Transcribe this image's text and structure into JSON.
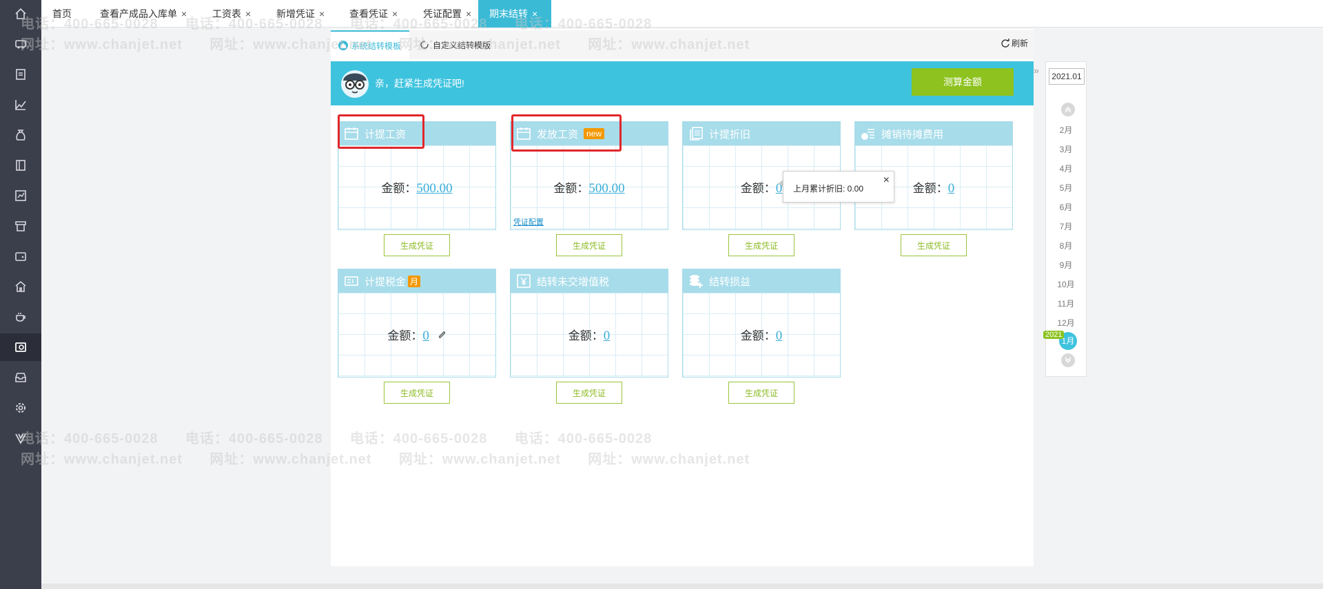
{
  "nav": {
    "items": [
      {
        "name": "home-icon",
        "icon": "home"
      },
      {
        "name": "car-icon",
        "icon": "car"
      },
      {
        "name": "list-icon",
        "icon": "list"
      },
      {
        "name": "chart-icon",
        "icon": "chart"
      },
      {
        "name": "money-bag-icon",
        "icon": "money-bag"
      },
      {
        "name": "book-icon",
        "icon": "book"
      },
      {
        "name": "report-icon",
        "icon": "report"
      },
      {
        "name": "store-icon",
        "icon": "store"
      },
      {
        "name": "wallet-icon",
        "icon": "wallet"
      },
      {
        "name": "building-icon",
        "icon": "building"
      },
      {
        "name": "tea-cup-icon",
        "icon": "tea-cup"
      },
      {
        "name": "voucher-icon",
        "icon": "voucher"
      },
      {
        "name": "inbox-icon",
        "icon": "inbox"
      },
      {
        "name": "settings-icon",
        "icon": "gear"
      },
      {
        "name": "v-logo-icon",
        "icon": "v-logo"
      }
    ]
  },
  "tabs": [
    {
      "label": "首页",
      "closable": false
    },
    {
      "label": "查看产成品入库单",
      "closable": true
    },
    {
      "label": "工资表",
      "closable": true
    },
    {
      "label": "新增凭证",
      "closable": true
    },
    {
      "label": "查看凭证",
      "closable": true
    },
    {
      "label": "凭证配置",
      "closable": true
    },
    {
      "label": "期末结转",
      "closable": true,
      "active": true
    }
  ],
  "close_glyph": "×",
  "subtabs": [
    {
      "label": "系统结转模板",
      "active": true
    },
    {
      "label": "自定义结转模版",
      "active": false
    }
  ],
  "refresh_label": "刷新",
  "banner": {
    "message": "亲，赶紧生成凭证吧!",
    "calc_button": "测算金额"
  },
  "cards": [
    {
      "title": "计提工资",
      "amount_label": "金额：",
      "amount": "500.00",
      "generate": "生成凭证",
      "icon": "calendar-icon",
      "highlight": true
    },
    {
      "title": "发放工资",
      "badge": "new",
      "amount_label": "金额：",
      "amount": "500.00",
      "link": "凭证配置",
      "generate": "生成凭证",
      "icon": "calendar-icon",
      "highlight": true
    },
    {
      "title": "计提折旧",
      "amount_label": "金额：",
      "amount": "0",
      "generate": "生成凭证",
      "icon": "document-stack-icon"
    },
    {
      "title": "摊销待摊费用",
      "amount_label": "金额：",
      "amount": "0",
      "generate": "生成凭证",
      "icon": "coin-list-icon"
    },
    {
      "title": "计提税金",
      "badge": "月",
      "amount_label": "金额：",
      "amount": "0",
      "attachment": true,
      "generate": "生成凭证",
      "icon": "tax-icon"
    },
    {
      "title": "结转未交增值税",
      "amount_label": "金额：",
      "amount": "0",
      "generate": "生成凭证",
      "icon": "yen-icon"
    },
    {
      "title": "结转损益",
      "amount_label": "金额：",
      "amount": "0",
      "generate": "生成凭证",
      "icon": "coins-plus-icon"
    }
  ],
  "tooltip": {
    "text": "上月累计折旧: 0.00",
    "close": "×"
  },
  "period": {
    "current": "2021.01",
    "months": [
      "2月",
      "3月",
      "4月",
      "5月",
      "6月",
      "7月",
      "8月",
      "9月",
      "10月",
      "11月",
      "12月"
    ],
    "selected": "1月",
    "year_badge": "2021"
  },
  "watermark": {
    "phone": "电话：400-665-0028",
    "site": "网址：www.chanjet.net"
  },
  "colors": {
    "accent": "#3bbad6",
    "banner": "#3ec3de",
    "green": "#8dc21f",
    "card_head": "#a7dcea",
    "highlight": "#e0262a",
    "badge": "#f39800",
    "nav_bg": "#3b3e4b"
  }
}
